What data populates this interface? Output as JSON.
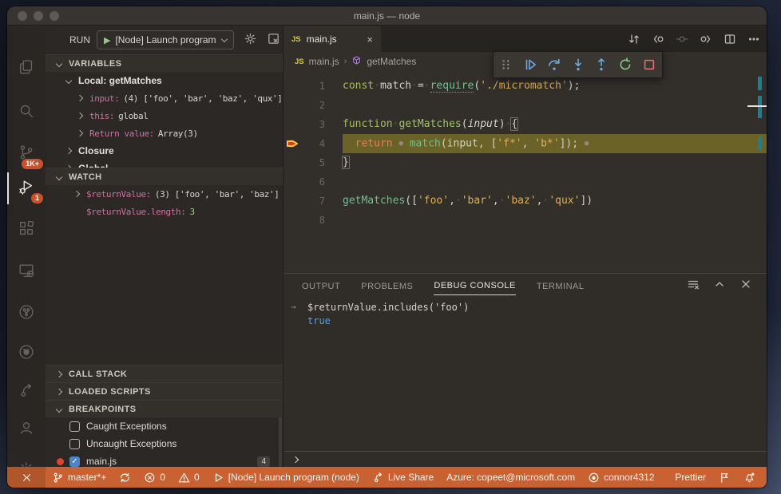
{
  "window": {
    "title": "main.js — node"
  },
  "colors": {
    "status_orange": "#c86233",
    "badge_orange": "#c8522c",
    "current_line": "#6a6226",
    "breakpoint_red": "#d8392e",
    "debug_arrow_yellow": "#f7c53d",
    "ruler_teal": "#1b7e93",
    "result_blue": "#4fa3e3",
    "keyword_green": "#a6bd68",
    "string_yellow": "#dfae5c",
    "return_salmon": "#e87e5a",
    "var_pink": "#d170a2"
  },
  "activity_bar": {
    "items": [
      {
        "name": "explorer",
        "icon": "files-icon"
      },
      {
        "name": "search",
        "icon": "search-icon"
      },
      {
        "name": "source-control",
        "icon": "git-branch-icon",
        "badge": "1K+"
      },
      {
        "name": "run-and-debug",
        "icon": "debug-icon",
        "badge": "1",
        "active": true
      },
      {
        "name": "extensions",
        "icon": "extensions-icon"
      },
      {
        "name": "remote-explorer",
        "icon": "remote-icon"
      },
      {
        "name": "git-graph",
        "icon": "fork-circle-icon"
      },
      {
        "name": "github",
        "icon": "github-icon"
      },
      {
        "name": "live-share",
        "icon": "share-icon"
      },
      {
        "name": "accounts",
        "icon": "account-icon"
      },
      {
        "name": "settings",
        "icon": "gear-icon"
      }
    ]
  },
  "run_bar": {
    "label": "RUN",
    "config": "[Node] Launch program"
  },
  "sidebar": {
    "variables": {
      "header": "VARIABLES",
      "rows": [
        {
          "level": 1,
          "chevron": "down",
          "label": "Local: getMatches"
        },
        {
          "level": 2,
          "chevron": "right",
          "name": "input:",
          "value": "(4) ['foo', 'bar', 'baz', 'qux']"
        },
        {
          "level": 2,
          "chevron": "right",
          "name": "this:",
          "value": "global"
        },
        {
          "level": 2,
          "chevron": "right",
          "name": "Return value:",
          "value": "Array(3)"
        },
        {
          "level": 1,
          "chevron": "right",
          "label": "Closure"
        },
        {
          "level": 1,
          "chevron": "right",
          "label": "Global"
        }
      ]
    },
    "watch": {
      "header": "WATCH",
      "rows": [
        {
          "chevron": "right",
          "name": "$returnValue:",
          "value": "(3) ['foo', 'bar', 'baz']"
        },
        {
          "chevron": null,
          "name": "$returnValue.length:",
          "value": "3",
          "value_class": "num"
        }
      ]
    },
    "lower_sections": [
      {
        "label": "CALL STACK",
        "chevron": "right"
      },
      {
        "label": "LOADED SCRIPTS",
        "chevron": "right"
      },
      {
        "label": "BREAKPOINTS",
        "chevron": "down"
      }
    ],
    "breakpoints": [
      {
        "label": "Caught Exceptions",
        "checked": false
      },
      {
        "label": "Uncaught Exceptions",
        "checked": false
      },
      {
        "label": "main.js",
        "checked": true,
        "red_dot": true,
        "badge": "4"
      }
    ]
  },
  "editor": {
    "tab": {
      "label": "main.js",
      "icon_text": "JS",
      "close": "×"
    },
    "breadcrumb": {
      "icon_text": "JS",
      "file": "main.js",
      "separator": "›",
      "symbol": "getMatches"
    },
    "actions": [
      {
        "name": "open-changes"
      },
      {
        "name": "previous-change"
      },
      {
        "name": "current-change",
        "disabled": true
      },
      {
        "name": "next-change"
      },
      {
        "name": "split-editor"
      },
      {
        "name": "more-actions"
      }
    ],
    "lines": [
      {
        "num": "1",
        "tokens": [
          [
            "kw",
            "const"
          ],
          [
            "ws",
            "·"
          ],
          [
            "pl",
            "match"
          ],
          [
            "ws",
            "·"
          ],
          [
            "pl",
            "="
          ],
          [
            "ws",
            "·"
          ],
          [
            "fnu",
            "require"
          ],
          [
            "pl",
            "("
          ],
          [
            "str",
            "'./micromatch'"
          ],
          [
            "pl",
            ");"
          ]
        ]
      },
      {
        "num": "2",
        "tokens": []
      },
      {
        "num": "3",
        "tokens": [
          [
            "kw",
            "function"
          ],
          [
            "ws",
            "·"
          ],
          [
            "fnd",
            "getMatches"
          ],
          [
            "pl",
            "("
          ],
          [
            "param",
            "input"
          ],
          [
            "pl",
            ")"
          ],
          [
            "ws",
            "·"
          ],
          [
            "brk",
            "{"
          ]
        ]
      },
      {
        "num": "4",
        "current": true,
        "tokens": [
          [
            "ws",
            "··"
          ],
          [
            "ret",
            "return"
          ],
          [
            "ws",
            "·"
          ],
          [
            "dot",
            "●"
          ],
          [
            "sp",
            " "
          ],
          [
            "fn",
            "match"
          ],
          [
            "pl",
            "(input,"
          ],
          [
            "ws",
            "·"
          ],
          [
            "pl",
            "["
          ],
          [
            "str",
            "'f*'"
          ],
          [
            "pl",
            ","
          ],
          [
            "ws",
            "·"
          ],
          [
            "str",
            "'b*'"
          ],
          [
            "pl",
            "]);"
          ],
          [
            "sp",
            " "
          ],
          [
            "dot",
            "●"
          ]
        ]
      },
      {
        "num": "5",
        "tokens": [
          [
            "brk",
            "}"
          ]
        ]
      },
      {
        "num": "6",
        "tokens": []
      },
      {
        "num": "7",
        "tokens": [
          [
            "fn",
            "getMatches"
          ],
          [
            "pl",
            "(["
          ],
          [
            "str",
            "'foo'"
          ],
          [
            "pl",
            ","
          ],
          [
            "ws",
            "·"
          ],
          [
            "str",
            "'bar'"
          ],
          [
            "pl",
            ","
          ],
          [
            "ws",
            "·"
          ],
          [
            "str",
            "'baz'"
          ],
          [
            "pl",
            ","
          ],
          [
            "ws",
            "·"
          ],
          [
            "str",
            "'qux'"
          ],
          [
            "pl",
            "])"
          ]
        ]
      },
      {
        "num": "8",
        "tokens": []
      }
    ]
  },
  "debug_toolbar": {
    "buttons": [
      {
        "name": "drag-grip"
      },
      {
        "name": "continue"
      },
      {
        "name": "step-over"
      },
      {
        "name": "step-into"
      },
      {
        "name": "step-out"
      },
      {
        "name": "restart"
      },
      {
        "name": "stop"
      }
    ]
  },
  "panel": {
    "tabs": [
      {
        "label": "OUTPUT"
      },
      {
        "label": "PROBLEMS"
      },
      {
        "label": "DEBUG CONSOLE",
        "active": true
      },
      {
        "label": "TERMINAL"
      }
    ],
    "icons": [
      {
        "name": "clear-console"
      },
      {
        "name": "collapse-panel"
      },
      {
        "name": "close-panel"
      }
    ],
    "console": [
      {
        "kind": "input",
        "gutter": "→",
        "text": "$returnValue.includes('foo')"
      },
      {
        "kind": "result",
        "text": "true"
      }
    ]
  },
  "status_bar": {
    "left": [
      {
        "name": "remote-indicator",
        "icon": "remote-angles",
        "text": ""
      },
      {
        "name": "git-branch",
        "icon": "branch",
        "text": "master*+"
      },
      {
        "name": "sync",
        "icon": "sync",
        "text": ""
      },
      {
        "name": "errors",
        "icon": "error",
        "text": "0"
      },
      {
        "name": "warnings",
        "icon": "warning",
        "text": "0"
      },
      {
        "name": "debug-launch",
        "icon": "play-outline",
        "text": "[Node] Launch program (node)"
      },
      {
        "name": "live-share",
        "icon": "live-share",
        "text": "Live Share"
      },
      {
        "name": "azure-account",
        "icon": null,
        "text": "Azure: copeet@microsoft.com"
      },
      {
        "name": "github-account",
        "icon": "github-ring",
        "text": "connor4312"
      }
    ],
    "right": [
      {
        "name": "prettier",
        "icon": null,
        "text": "Prettier"
      },
      {
        "name": "feedback",
        "icon": "flag",
        "text": ""
      },
      {
        "name": "notifications",
        "icon": "bell-dot",
        "text": ""
      }
    ]
  }
}
